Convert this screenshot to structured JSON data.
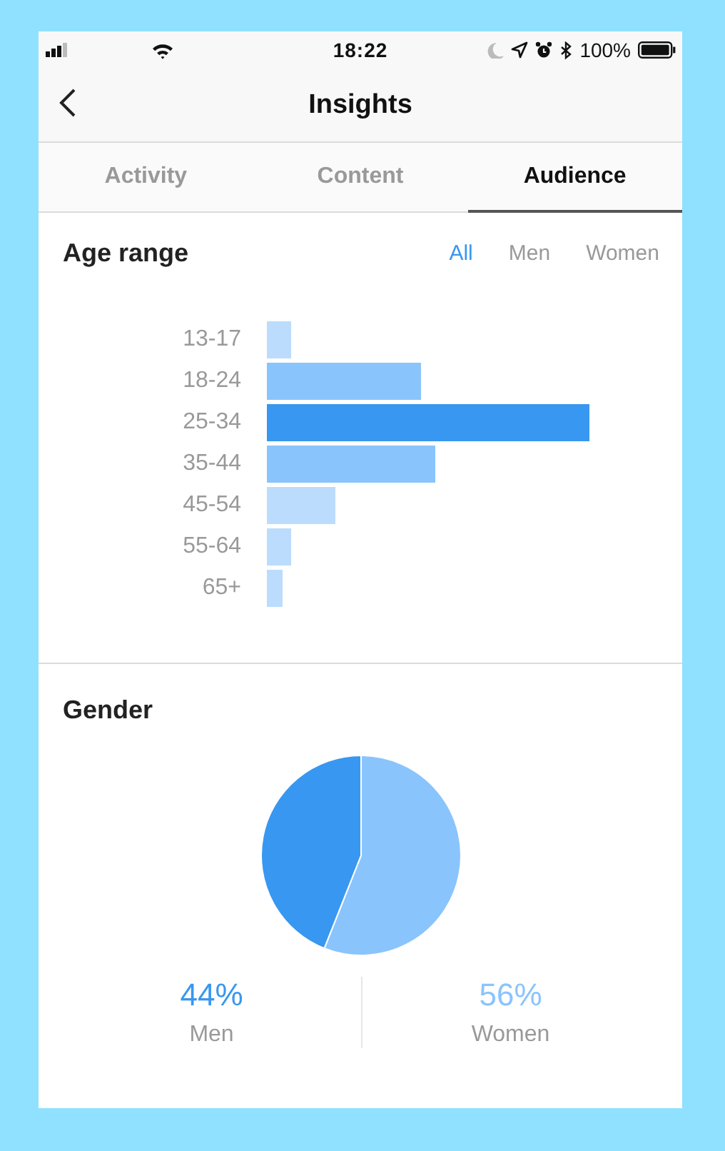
{
  "status_bar": {
    "time": "18:22",
    "battery": "100%"
  },
  "nav": {
    "title": "Insights"
  },
  "tabs": [
    {
      "label": "Activity",
      "selected": false
    },
    {
      "label": "Content",
      "selected": false
    },
    {
      "label": "Audience",
      "selected": true
    }
  ],
  "age_range": {
    "title": "Age range",
    "filters": [
      {
        "label": "All",
        "selected": true
      },
      {
        "label": "Men",
        "selected": false
      },
      {
        "label": "Women",
        "selected": false
      }
    ],
    "groups": [
      {
        "label": "13-17",
        "color": "#bcdcfd"
      },
      {
        "label": "18-24",
        "color": "#8ac4fd"
      },
      {
        "label": "25-34",
        "color": "#3897f0"
      },
      {
        "label": "35-44",
        "color": "#8ac4fd"
      },
      {
        "label": "45-54",
        "color": "#bcdcfd"
      },
      {
        "label": "55-64",
        "color": "#bcdcfd"
      },
      {
        "label": "65+",
        "color": "#bcdcfd"
      }
    ]
  },
  "gender": {
    "title": "Gender",
    "chart_data": {
      "type": "pie",
      "values": [
        44,
        56
      ]
    },
    "legend": [
      {
        "value": "44%",
        "label": "Men",
        "color": "#3897f0"
      },
      {
        "value": "56%",
        "label": "Women",
        "color": "#8ac4fd"
      }
    ]
  }
}
